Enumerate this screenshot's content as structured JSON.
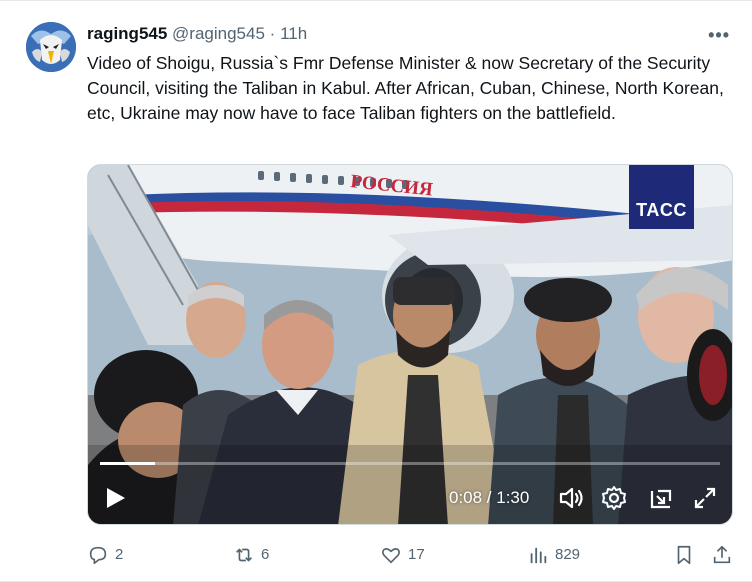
{
  "author": {
    "display_name": "raging545",
    "handle": "@raging545",
    "separator": "·",
    "time": "11h"
  },
  "more_label": "•••",
  "tweet_text": "Video of Shoigu, Russia`s Fmr Defense Minister & now  Secretary of the Security Council, visiting the Taliban in Kabul. After African, Cuban, Chinese, North Korean, etc, Ukraine may now have to face Taliban fighters on the battlefield.",
  "video": {
    "watermark": "TACC",
    "plane_text": "РОССИЯ",
    "current_time": "0:08",
    "duration": "1:30",
    "timecode": "0:08 / 1:30",
    "progress_fraction": 0.089
  },
  "actions": {
    "replies": "2",
    "reposts": "6",
    "likes": "17",
    "views": "829"
  },
  "colors": {
    "text": "#0f1419",
    "secondary": "#536471",
    "tass_blue": "#1e2a78",
    "stripe_red": "#c5283d",
    "stripe_blue": "#2a4fa0"
  }
}
